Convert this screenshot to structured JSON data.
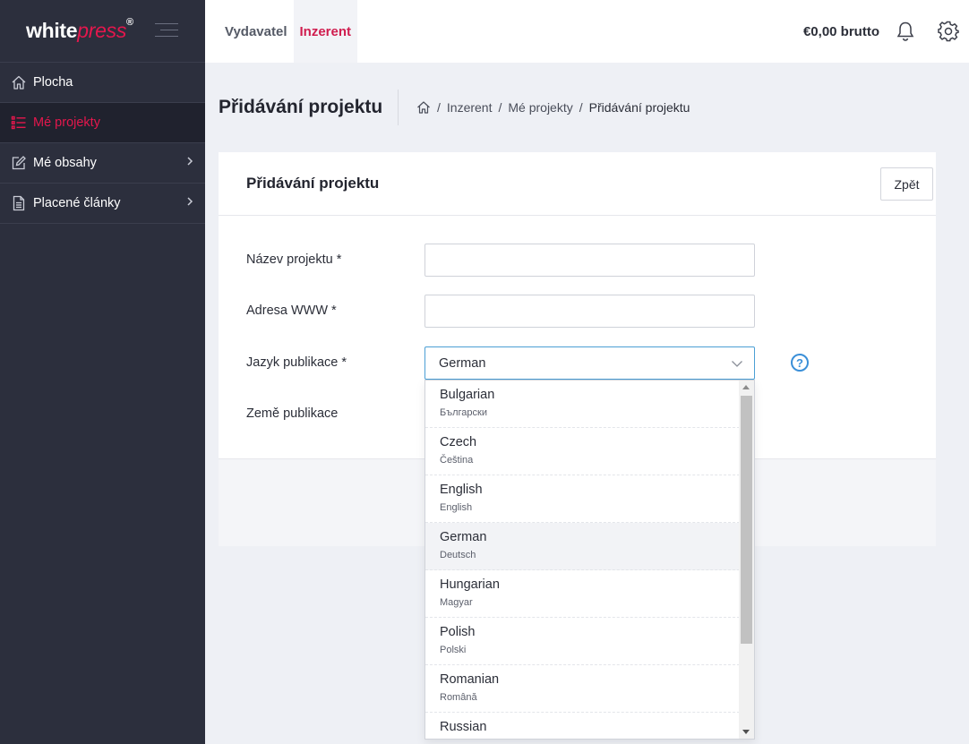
{
  "brand": {
    "white": "white",
    "press": "press",
    "mark": "®"
  },
  "sidebar": {
    "items": [
      {
        "label": "Plocha",
        "icon": "home-icon"
      },
      {
        "label": "Mé projekty",
        "icon": "list-icon",
        "active": true
      },
      {
        "label": "Mé obsahy",
        "icon": "edit-icon",
        "has_children": true
      },
      {
        "label": "Placené články",
        "icon": "document-icon",
        "has_children": true
      }
    ]
  },
  "topbar": {
    "tabs": [
      {
        "label": "Vydavatel"
      },
      {
        "label": "Inzerent",
        "active": true
      }
    ],
    "balance": "€0,00 brutto"
  },
  "header": {
    "title": "Přidávání projektu",
    "breadcrumb": [
      "Inzerent",
      "Mé projekty",
      "Přidávání projektu"
    ]
  },
  "card": {
    "title": "Přidávání projektu",
    "back_label": "Zpět"
  },
  "form": {
    "name_label": "Název projektu *",
    "name_value": "",
    "url_label": "Adresa WWW *",
    "url_value": "",
    "language_label": "Jazyk publikace *",
    "language_value": "German",
    "country_label": "Země publikace"
  },
  "language_options": [
    {
      "name": "Bulgarian",
      "native": "Български"
    },
    {
      "name": "Czech",
      "native": "Čeština"
    },
    {
      "name": "English",
      "native": "English"
    },
    {
      "name": "German",
      "native": "Deutsch",
      "selected": true
    },
    {
      "name": "Hungarian",
      "native": "Magyar"
    },
    {
      "name": "Polish",
      "native": "Polski"
    },
    {
      "name": "Romanian",
      "native": "Română"
    },
    {
      "name": "Russian",
      "native": ""
    }
  ],
  "colors": {
    "accent": "#e4174d",
    "sidebar_bg": "#2c2f3d",
    "focus_border": "#4b9fd5",
    "help": "#3a8fd8"
  }
}
